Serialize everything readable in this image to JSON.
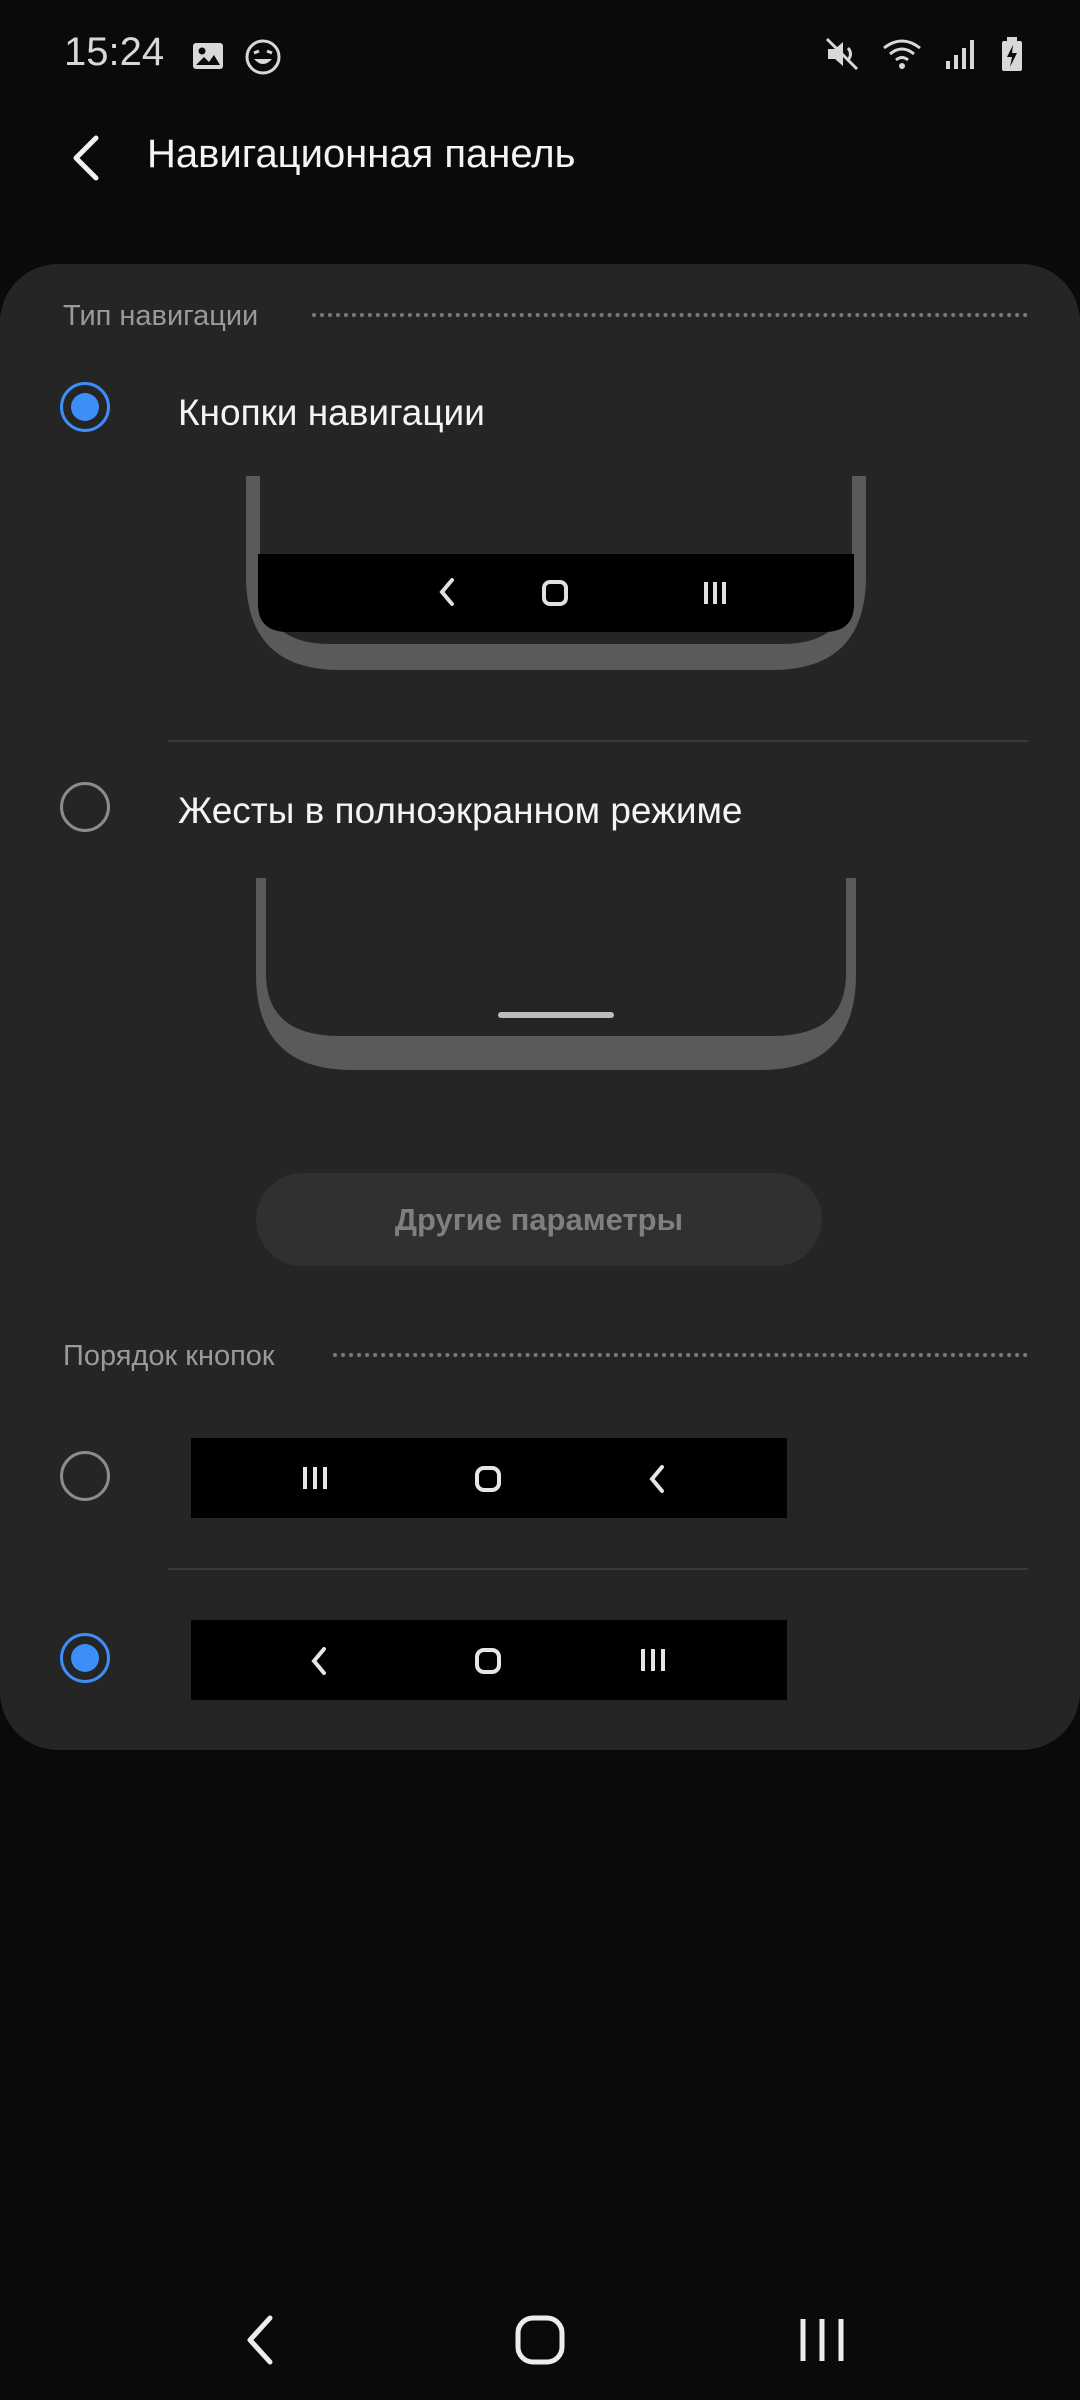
{
  "status_bar": {
    "time": "15:24"
  },
  "header": {
    "title": "Навигационная панель"
  },
  "navigation_type": {
    "section_label": "Тип навигации",
    "options": [
      {
        "label": "Кнопки навигации",
        "selected": true
      },
      {
        "label": "Жесты в полноэкранном режиме",
        "selected": false
      }
    ],
    "more_button_label": "Другие параметры"
  },
  "button_order": {
    "section_label": "Порядок кнопок",
    "options": [
      {
        "icons": [
          "recents-icon",
          "home-icon",
          "back-icon"
        ],
        "selected": false
      },
      {
        "icons": [
          "back-icon",
          "home-icon",
          "recents-icon"
        ],
        "selected": true
      }
    ]
  },
  "colors": {
    "accent": "#3e8ef7",
    "card": "#252525",
    "background": "#0a0a0a"
  }
}
